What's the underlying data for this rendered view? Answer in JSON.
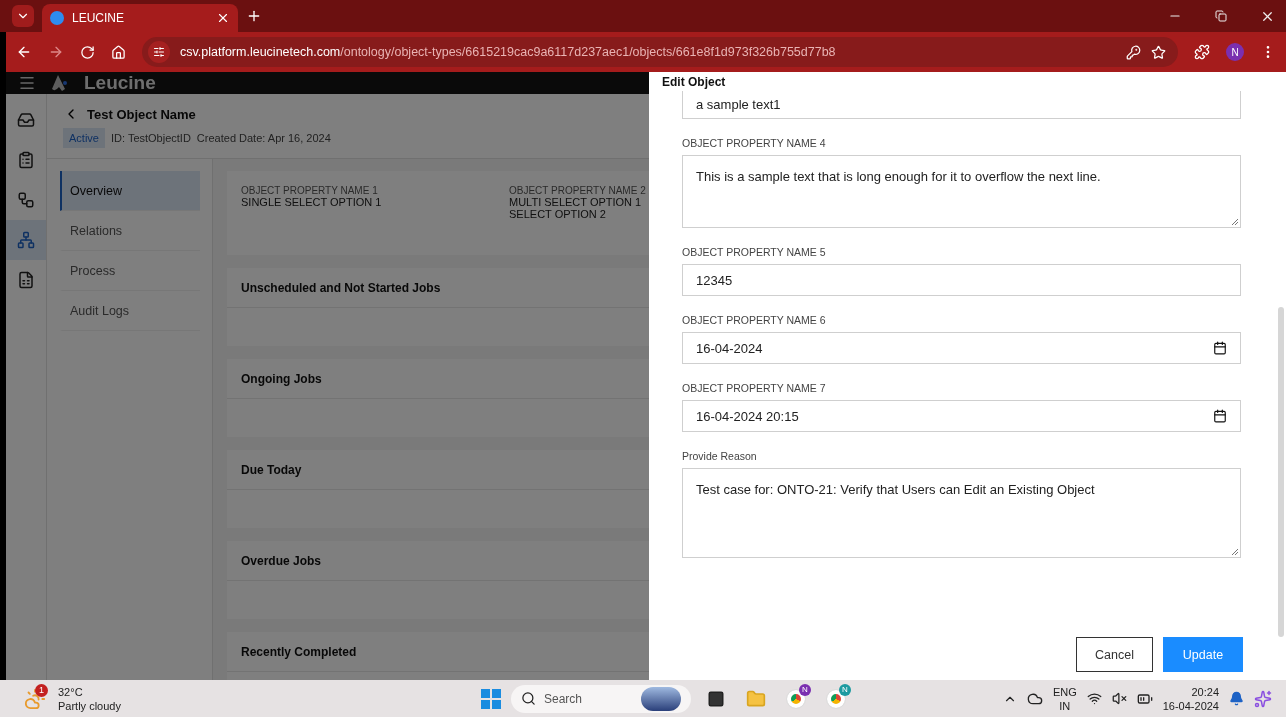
{
  "browser": {
    "tab_title": "LEUCINE",
    "url_host": "csv.platform.leucinetech.com",
    "url_path": "/ontology/object-types/6615219cac9a6117d237aec1/objects/661e8f1d973f326b755d77b8",
    "profile": "N"
  },
  "app": {
    "brand": "Leucine",
    "nav_icons": [
      {
        "kind": "inbox",
        "selected": false
      },
      {
        "kind": "checklist",
        "selected": false
      },
      {
        "kind": "flow",
        "selected": false
      },
      {
        "kind": "hierarchy",
        "selected": true
      },
      {
        "kind": "report",
        "selected": false
      }
    ],
    "title": "Test Object Name",
    "status": "Active",
    "id_text": "ID: TestObjectID",
    "created_text": "Created Date: Apr 16, 2024",
    "tabs": [
      {
        "label": "Overview",
        "selected": true
      },
      {
        "label": "Relations",
        "selected": false
      },
      {
        "label": "Process",
        "selected": false
      },
      {
        "label": "Audit Logs",
        "selected": false
      }
    ],
    "properties": [
      {
        "label": "OBJECT PROPERTY NAME 1",
        "values": [
          "SINGLE SELECT OPTION 1"
        ]
      },
      {
        "label": "OBJECT PROPERTY NAME 2",
        "values": [
          "MULTI SELECT OPTION 1",
          "SELECT OPTION 2"
        ]
      }
    ],
    "sections": [
      "Unscheduled and Not Started Jobs",
      "Ongoing Jobs",
      "Due Today",
      "Overdue Jobs",
      "Recently Completed"
    ]
  },
  "drawer": {
    "title": "Edit Object",
    "fields": [
      {
        "kind": "text",
        "value": "a sample text1"
      },
      {
        "kind": "textarea",
        "label": "OBJECT PROPERTY NAME 4",
        "value": "This is a sample text that is long enough for it to overflow the next line."
      },
      {
        "kind": "text",
        "label": "OBJECT PROPERTY NAME 5",
        "value": "12345"
      },
      {
        "kind": "date",
        "label": "OBJECT PROPERTY NAME 6",
        "value": "16-04-2024"
      },
      {
        "kind": "date",
        "label": "OBJECT PROPERTY NAME 7",
        "value": "16-04-2024 20:15"
      },
      {
        "kind": "reason",
        "label": "Provide Reason",
        "value": "Test case for: ONTO-21: Verify that Users can Edit an Existing Object"
      }
    ],
    "buttons": [
      {
        "label": "Cancel",
        "kind": "secondary"
      },
      {
        "label": "Update",
        "kind": "primary"
      }
    ]
  },
  "taskbar": {
    "weather_badge": "1",
    "temperature": "32°C",
    "condition": "Partly cloudy",
    "search_placeholder": "Search",
    "lang": "ENG",
    "region": "IN",
    "time": "20:24",
    "date": "16-04-2024",
    "chrome_profile_a": "N",
    "chrome_profile_b": "N"
  }
}
